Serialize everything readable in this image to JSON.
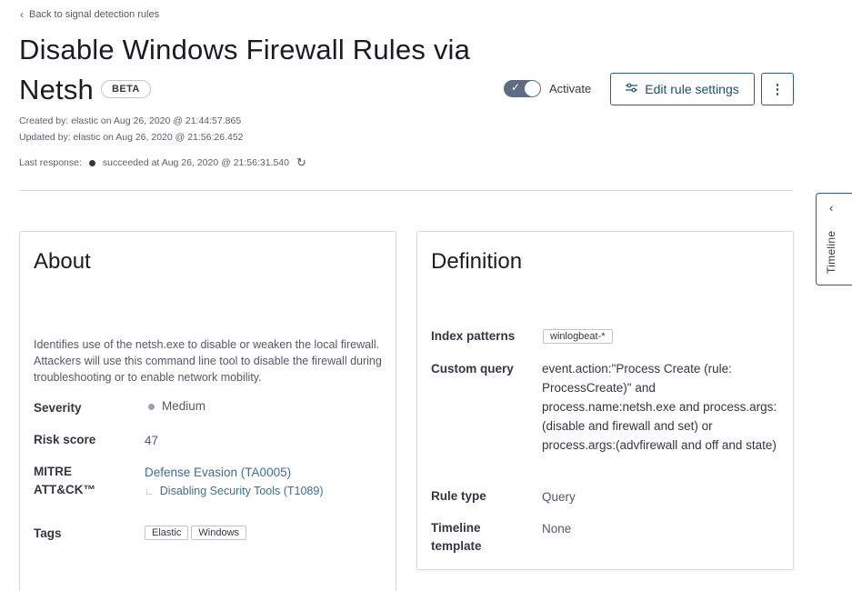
{
  "header": {
    "back_link": "Back to signal detection rules",
    "title": "Disable Windows Firewall Rules via Netsh",
    "badge": "BETA",
    "created": "Created by: elastic on Aug 26, 2020 @ 21:44:57.865",
    "updated": "Updated by: elastic on Aug 26, 2020 @ 21:56:26.452",
    "last_response_label": "Last response:",
    "last_response_value": "succeeded at Aug 26, 2020 @ 21:56:31.540",
    "activate_label": "Activate",
    "activate_on": true,
    "edit_button": "Edit rule settings"
  },
  "timeline_tab": {
    "label": "Timeline"
  },
  "about": {
    "title": "About",
    "description": "Identifies use of the netsh.exe to disable or weaken the local firewall. Attackers will use this command line tool to disable the firewall during troubleshooting or to enable network mobility.",
    "severity_label": "Severity",
    "severity_value": "Medium",
    "risk_label": "Risk score",
    "risk_value": "47",
    "mitre_label": "MITRE ATT&CK™",
    "mitre_tactic": "Defense Evasion (TA0005)",
    "mitre_technique": "Disabling Security Tools (T1089)",
    "tags_label": "Tags",
    "tags": [
      "Elastic",
      "Windows"
    ]
  },
  "definition": {
    "title": "Definition",
    "index_label": "Index patterns",
    "index_value": "winlogbeat-*",
    "query_label": "Custom query",
    "query_value": "event.action:\"Process Create (rule: ProcessCreate)\" and process.name:netsh.exe and process.args:(disable and firewall and set) or process.args:(advfirewall and off and state)",
    "rule_type_label": "Rule type",
    "rule_type_value": "Query",
    "timeline_label": "Timeline template",
    "timeline_value": "None"
  },
  "colors": {
    "accent": "#1f4e6b",
    "link": "#3f6e8c",
    "toggle": "#5e6b82"
  }
}
